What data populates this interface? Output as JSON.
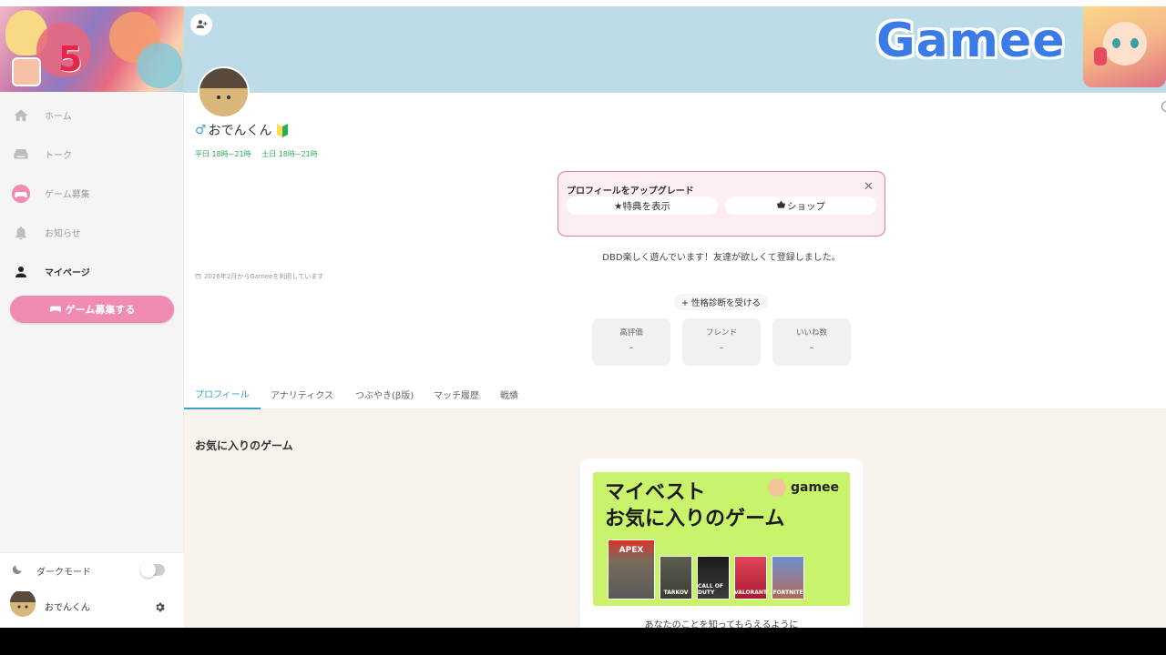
{
  "sidebar": {
    "nav": [
      {
        "label": "ホーム",
        "icon": "home-icon"
      },
      {
        "label": "トーク",
        "icon": "sofa-icon"
      },
      {
        "label": "ゲーム募集",
        "icon": "gamepad-icon"
      },
      {
        "label": "お知らせ",
        "icon": "bell-icon"
      },
      {
        "label": "マイページ",
        "icon": "person-icon"
      }
    ],
    "active_index": 4,
    "cta_label": "ゲーム募集する",
    "dark_mode_label": "ダークモード",
    "dark_mode_on": false,
    "user_name": "おでんくん"
  },
  "profile": {
    "logo": "Gamee",
    "gender_symbol": "♂",
    "name": "おでんくん",
    "times": [
      "平日 18時~21時",
      "土日 18時~21時"
    ],
    "upgrade": {
      "title": "プロフィールをアップグレード",
      "close": "✕",
      "perks_label": "★特典を表示",
      "shop_label": "ショップ"
    },
    "bio": "DBD楽しく遊んでいます！友達が欲しくて登録しました。",
    "since": "2026年2月からGameeを利用しています",
    "diagnosis_label": "+ 性格診断を受ける",
    "stats": [
      {
        "label": "高評価",
        "value": "–"
      },
      {
        "label": "フレンド",
        "value": "–"
      },
      {
        "label": "いいね数",
        "value": "–"
      }
    ]
  },
  "tabs": [
    "プロフィール",
    "アナリティクス",
    "つぶやき(β版)",
    "マッチ履歴",
    "戦績"
  ],
  "active_tab": 0,
  "favorites": {
    "section_title": "お気に入りのゲーム",
    "banner_line1": "マイベスト",
    "banner_line2": "お気に入りのゲーム",
    "banner_brand": "gamee",
    "games": [
      "APEX",
      "TARKOV",
      "CALL OF DUTY",
      "VALORANT",
      "FORTNITE"
    ],
    "description": "あなたのことを知ってもらえるように"
  },
  "colors": {
    "accent_pink": "#f08bb4",
    "cover_blue": "#bcdde8",
    "tab_active": "#3aa0c8",
    "time_green": "#2eaa5a"
  }
}
